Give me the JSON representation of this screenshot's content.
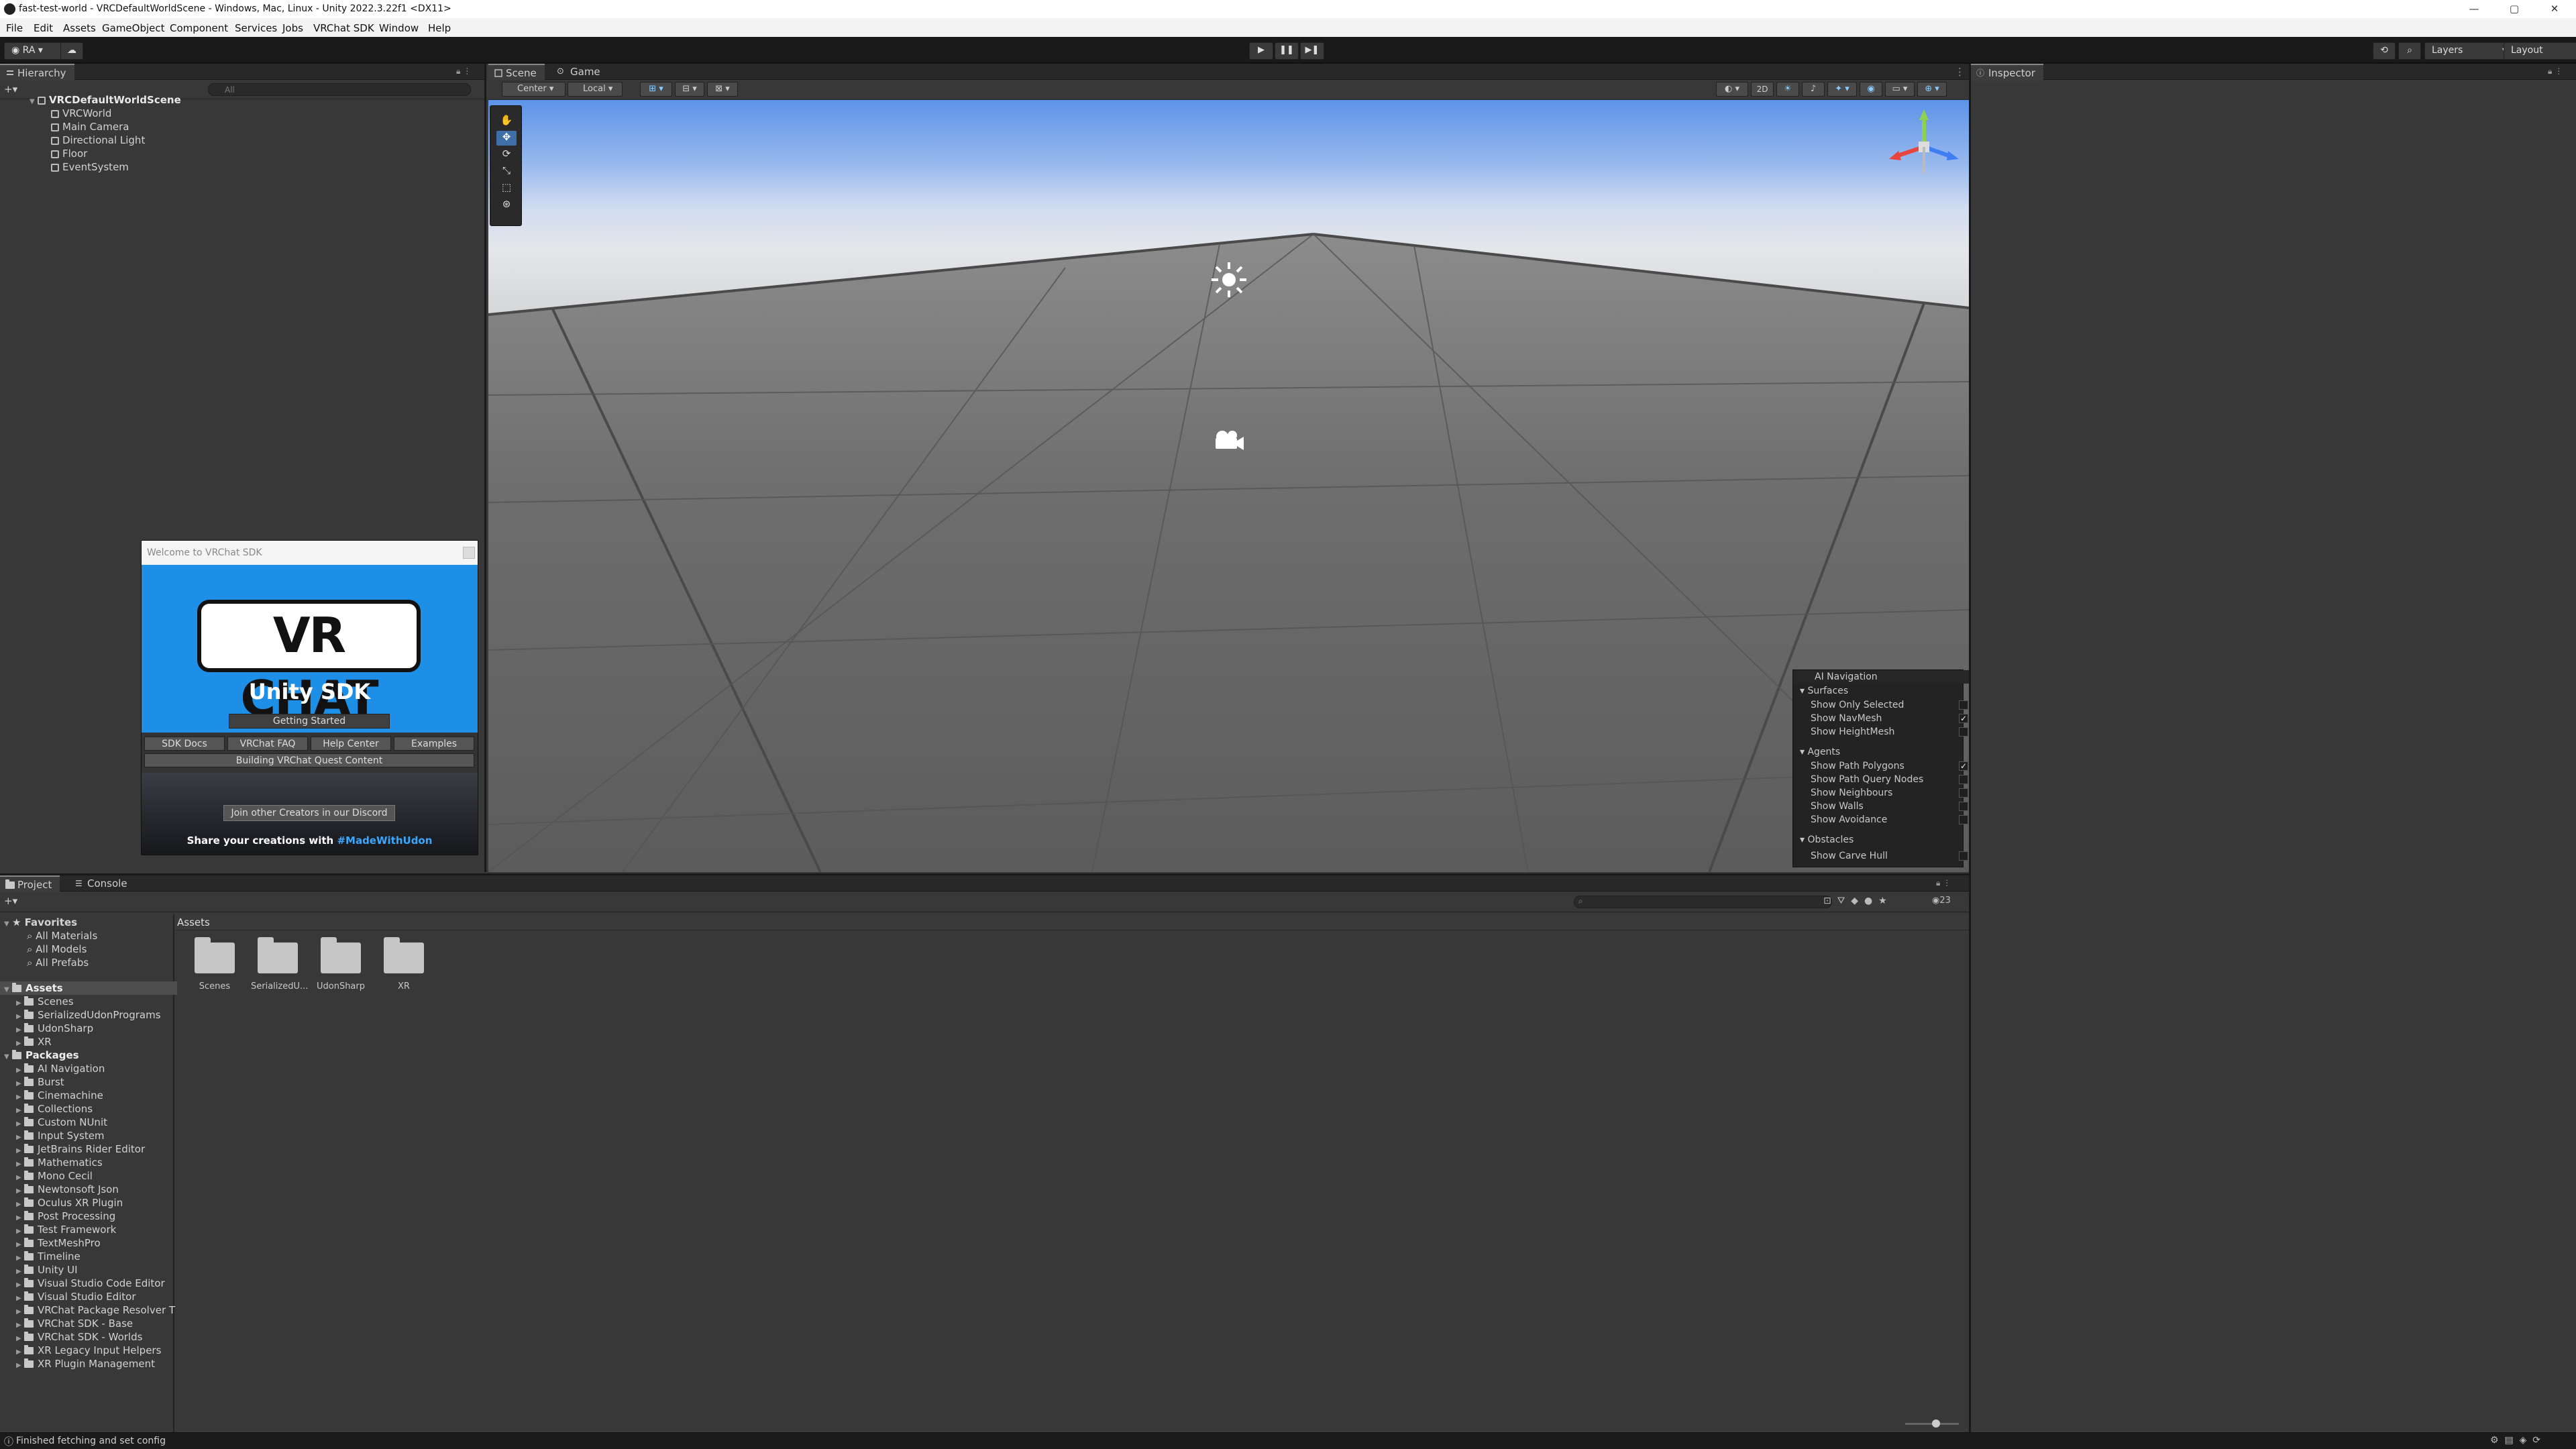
{
  "window": {
    "title": "fast-test-world - VRCDefaultWorldScene - Windows, Mac, Linux - Unity 2022.3.22f1 <DX11>",
    "controls": [
      "—",
      "▢",
      "✕"
    ]
  },
  "menu": [
    "File",
    "Edit",
    "Assets",
    "GameObject",
    "Component",
    "Services",
    "Jobs",
    "VRChat SDK",
    "Window",
    "Help"
  ],
  "toolbar": {
    "account": "RA ▾",
    "layers": "Layers",
    "layout": "Layout"
  },
  "hierarchy": {
    "tab": "Hierarchy",
    "search_placeholder": "All",
    "scene": "VRCDefaultWorldScene",
    "items": [
      "VRCWorld",
      "Main Camera",
      "Directional Light",
      "Floor",
      "EventSystem"
    ]
  },
  "scene": {
    "tabs": [
      "Scene",
      "Game"
    ],
    "pivot": "Center",
    "space": "Local",
    "mode_2d": "2D"
  },
  "welcome": {
    "title": "Welcome to VRChat SDK",
    "logo_text": "VR CHAT",
    "subtitle": "Unity SDK",
    "getting_started": "Getting Started",
    "buttons": [
      "SDK Docs",
      "VRChat FAQ",
      "Help Center",
      "Examples"
    ],
    "quest": "Building VRChat Quest Content",
    "discord": "Join other Creators in our Discord",
    "share_prefix": "Share your creations with ",
    "share_tag": "#MadeWithUdon"
  },
  "ai_navigation": {
    "title": "AI Navigation",
    "sections": [
      {
        "name": "Surfaces",
        "items": [
          {
            "label": "Show Only Selected",
            "checked": false
          },
          {
            "label": "Show NavMesh",
            "checked": true
          },
          {
            "label": "Show HeightMesh",
            "checked": false
          }
        ]
      },
      {
        "name": "Agents",
        "items": [
          {
            "label": "Show Path Polygons",
            "checked": true
          },
          {
            "label": "Show Path Query Nodes",
            "checked": false
          },
          {
            "label": "Show Neighbours",
            "checked": false
          },
          {
            "label": "Show Walls",
            "checked": false
          },
          {
            "label": "Show Avoidance",
            "checked": false
          }
        ]
      },
      {
        "name": "Obstacles",
        "items": [
          {
            "label": "Show Carve Hull",
            "checked": false
          }
        ]
      }
    ]
  },
  "inspector": {
    "tab": "Inspector"
  },
  "project": {
    "tabs": [
      "Project",
      "Console"
    ],
    "badge": "23",
    "favorites_label": "Favorites",
    "favorites": [
      "All Materials",
      "All Models",
      "All Prefabs"
    ],
    "assets_label": "Assets",
    "assets_children": [
      "Scenes",
      "SerializedUdonPrograms",
      "UdonSharp",
      "XR"
    ],
    "packages_label": "Packages",
    "packages": [
      "AI Navigation",
      "Burst",
      "Cinemachine",
      "Collections",
      "Custom NUnit",
      "Input System",
      "JetBrains Rider Editor",
      "Mathematics",
      "Mono Cecil",
      "Newtonsoft Json",
      "Oculus XR Plugin",
      "Post Processing",
      "Test Framework",
      "TextMeshPro",
      "Timeline",
      "Unity UI",
      "Visual Studio Code Editor",
      "Visual Studio Editor",
      "VRChat Package Resolver T",
      "VRChat SDK - Base",
      "VRChat SDK - Worlds",
      "XR Legacy Input Helpers",
      "XR Plugin Management"
    ],
    "breadcrumb": "Assets",
    "grid_items": [
      "Scenes",
      "SerializedU...",
      "UdonSharp",
      "XR"
    ]
  },
  "status": {
    "message": "Finished fetching and set config"
  }
}
